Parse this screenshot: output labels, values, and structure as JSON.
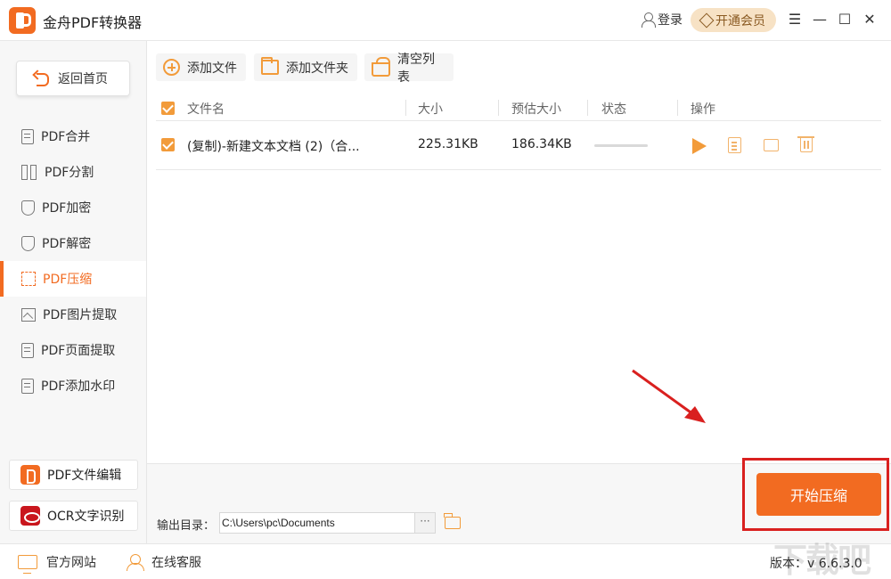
{
  "app": {
    "title": "金舟PDF转换器"
  },
  "header": {
    "login": "登录",
    "vip": "开通会员",
    "menu": "☰",
    "minimize": "—",
    "maximize": "☐",
    "close": "✕"
  },
  "sidebar": {
    "home": "返回首页",
    "items": [
      {
        "label": "PDF合并",
        "icon": "doc-icon"
      },
      {
        "label": "PDF分割",
        "icon": "split-icon"
      },
      {
        "label": "PDF加密",
        "icon": "shield-icon"
      },
      {
        "label": "PDF解密",
        "icon": "shield-icon"
      },
      {
        "label": "PDF压缩",
        "icon": "compress-icon",
        "active": true
      },
      {
        "label": "PDF图片提取",
        "icon": "image-icon"
      },
      {
        "label": "PDF页面提取",
        "icon": "doc-icon"
      },
      {
        "label": "PDF添加水印",
        "icon": "doc-icon"
      }
    ],
    "pdf_edit": "PDF文件编辑",
    "ocr": "OCR文字识别"
  },
  "toolbar": {
    "add_file": "添加文件",
    "add_folder": "添加文件夹",
    "clear_list": "清空列表"
  },
  "table": {
    "headers": {
      "name": "文件名",
      "size": "大小",
      "est_size": "预估大小",
      "status": "状态",
      "actions": "操作"
    },
    "rows": [
      {
        "name": "(复制)-新建文本文档 (2)（合...",
        "size": "225.31KB",
        "est_size": "186.34KB",
        "progress": 0
      }
    ]
  },
  "output": {
    "label": "输出目录：",
    "path": "C:\\Users\\pc\\Documents",
    "more": "···"
  },
  "start_button": "开始压缩",
  "footer": {
    "website": "官方网站",
    "service": "在线客服",
    "version": "版本：v 6.6.3.0"
  },
  "colors": {
    "accent": "#f26b21",
    "highlight": "#d9201f"
  },
  "watermark": "下载吧"
}
